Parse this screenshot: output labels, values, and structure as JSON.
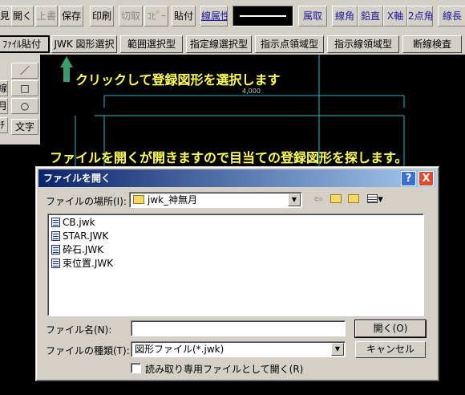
{
  "toolbar1": {
    "items": [
      "見",
      "開く",
      "上書",
      "保存",
      "印刷",
      "切取",
      "ｺﾋﾟｰ",
      "貼付",
      "線属性",
      "属取",
      "線角",
      "鉛直",
      "X軸",
      "2点角",
      "線長"
    ]
  },
  "toolbar2": {
    "items": [
      "ﾌｧｲﾙ貼付",
      "JWK 図形選択",
      "範囲選択型",
      "指定線選択型",
      "指示点領域型",
      "指示線領域型",
      "断線検査"
    ]
  },
  "sidebar": {
    "items": [
      "線",
      "月",
      "文字",
      "／",
      "□",
      "○"
    ]
  },
  "canvas": {
    "dimension_label": "4,000"
  },
  "annotations": {
    "click_hint": "クリックして登録図形を選択します",
    "dialog_hint": "ファイルを開くが開きますので目当ての登録図形を探します。"
  },
  "dialog": {
    "title": "ファイルを開く",
    "help": "?",
    "close": "X",
    "location_label": "ファイルの場所(I):",
    "location_value": "jwk_神無月",
    "files": [
      "CB.jwk",
      "STAR.JWK",
      "砕石.JWK",
      "束位置.JWK"
    ],
    "filename_label": "ファイル名(N):",
    "filename_value": "",
    "filetype_label": "ファイルの種類(T):",
    "filetype_value": "図形ファイル(*.jwk)",
    "readonly_label": "読み取り専用ファイルとして開く(R)",
    "open_button": "開く(O)",
    "cancel_button": "キャンセル"
  },
  "colors": {
    "canvas_bg": "#000000",
    "canvas_line": "#20b8c8",
    "annotation_text": "#ffff55",
    "arrow": "#3a9c6c",
    "title_start": "#0a246a",
    "title_end": "#a6caf0"
  }
}
